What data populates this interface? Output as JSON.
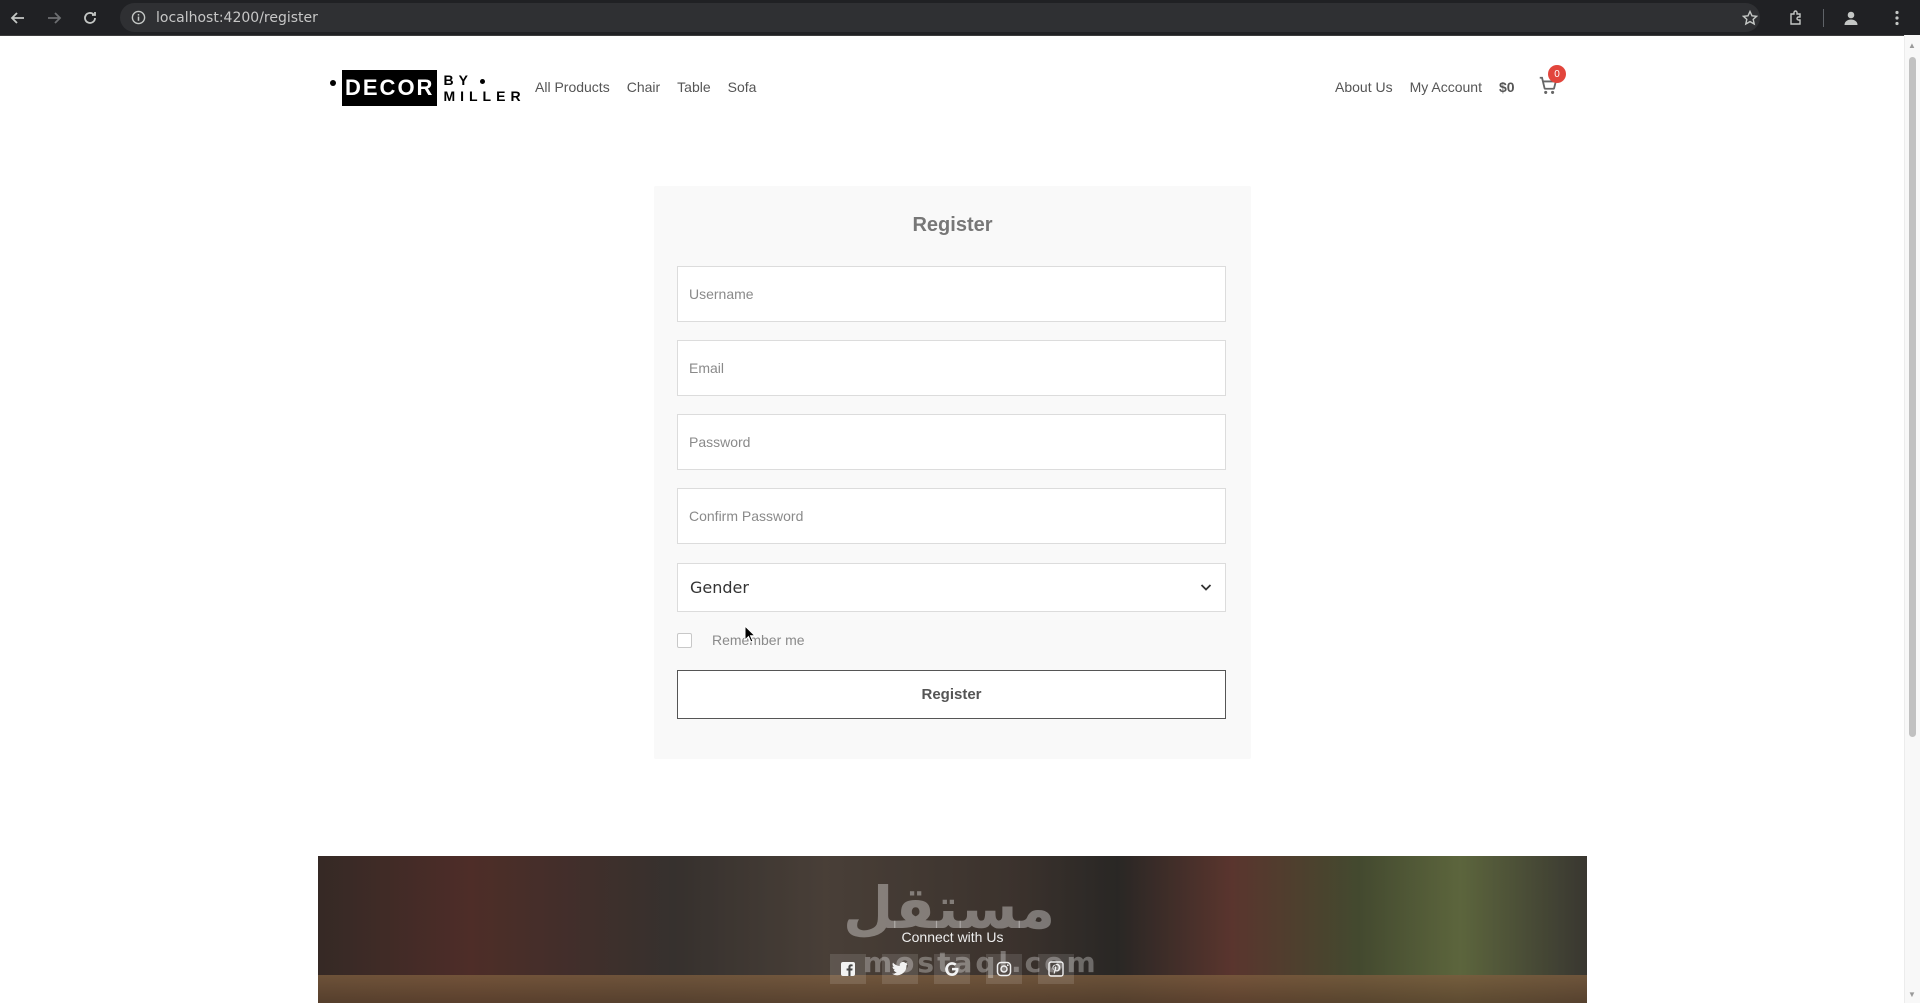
{
  "browser": {
    "url": "localhost:4200/register"
  },
  "brand": {
    "logo_main": "DECOR",
    "logo_by": "BY",
    "logo_sub": "MILLER"
  },
  "nav": {
    "left": [
      "All Products",
      "Chair",
      "Table",
      "Sofa"
    ],
    "about": "About Us",
    "account": "My Account",
    "cart_total": "$0",
    "cart_count": "0"
  },
  "form": {
    "title": "Register",
    "username_placeholder": "Username",
    "email_placeholder": "Email",
    "password_placeholder": "Password",
    "confirm_placeholder": "Confirm Password",
    "gender_selected": "Gender",
    "remember_label": "Remember me",
    "submit_label": "Register"
  },
  "footer": {
    "heading": "Connect with Us",
    "watermark": "مستقل",
    "watermark_latin": "mostaql.com",
    "socials": [
      "facebook-icon",
      "twitter-icon",
      "google-icon",
      "instagram-icon",
      "pinterest-icon"
    ]
  }
}
